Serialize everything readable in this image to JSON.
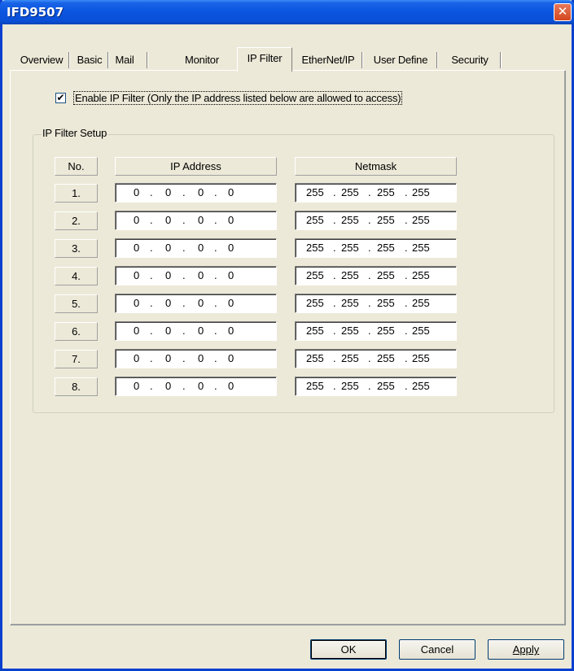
{
  "window": {
    "title": "IFD9507",
    "close_glyph": "✕"
  },
  "tabs": [
    {
      "label": "Overview"
    },
    {
      "label": "Basic"
    },
    {
      "label": "Mail"
    },
    {
      "label": "Monitor"
    },
    {
      "label": "IP Filter",
      "active": true
    },
    {
      "label": "EtherNet/IP"
    },
    {
      "label": "User Define"
    },
    {
      "label": "Security"
    }
  ],
  "enable_filter": {
    "checked": true,
    "check_glyph": "✔",
    "label": "Enable IP Filter  (Only the IP address listed below are allowed to access)"
  },
  "group": {
    "title": "IP Filter Setup",
    "headers": {
      "no": "No.",
      "ip": "IP Address",
      "mask": "Netmask"
    },
    "rows": [
      {
        "no": "1.",
        "ip": [
          "0",
          "0",
          "0",
          "0"
        ],
        "mask": [
          "255",
          "255",
          "255",
          "255"
        ]
      },
      {
        "no": "2.",
        "ip": [
          "0",
          "0",
          "0",
          "0"
        ],
        "mask": [
          "255",
          "255",
          "255",
          "255"
        ]
      },
      {
        "no": "3.",
        "ip": [
          "0",
          "0",
          "0",
          "0"
        ],
        "mask": [
          "255",
          "255",
          "255",
          "255"
        ]
      },
      {
        "no": "4.",
        "ip": [
          "0",
          "0",
          "0",
          "0"
        ],
        "mask": [
          "255",
          "255",
          "255",
          "255"
        ]
      },
      {
        "no": "5.",
        "ip": [
          "0",
          "0",
          "0",
          "0"
        ],
        "mask": [
          "255",
          "255",
          "255",
          "255"
        ]
      },
      {
        "no": "6.",
        "ip": [
          "0",
          "0",
          "0",
          "0"
        ],
        "mask": [
          "255",
          "255",
          "255",
          "255"
        ]
      },
      {
        "no": "7.",
        "ip": [
          "0",
          "0",
          "0",
          "0"
        ],
        "mask": [
          "255",
          "255",
          "255",
          "255"
        ]
      },
      {
        "no": "8.",
        "ip": [
          "0",
          "0",
          "0",
          "0"
        ],
        "mask": [
          "255",
          "255",
          "255",
          "255"
        ]
      }
    ]
  },
  "buttons": {
    "ok": "OK",
    "cancel": "Cancel",
    "apply": "Apply"
  },
  "colors": {
    "titlebar": "#0a55e0",
    "dialog_bg": "#ece9d8",
    "close": "#d4471f"
  }
}
